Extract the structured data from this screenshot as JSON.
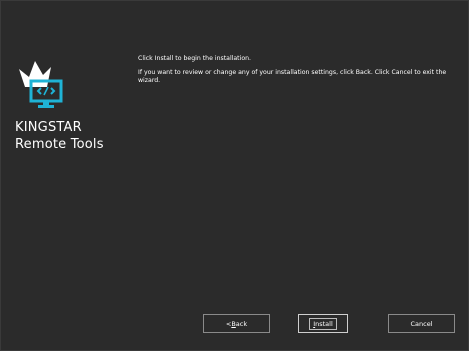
{
  "sidebar": {
    "brand_line1": "KINGSTAR",
    "brand_line2": "Remote Tools",
    "colors": {
      "crown": "#ffffff",
      "monitor": "#1fb3d6"
    }
  },
  "main": {
    "line1": "Click Install to begin the installation.",
    "line2": "If you want to review or change any of your installation settings, click Back. Click Cancel to exit the wizard."
  },
  "buttons": {
    "back_prefix": "< ",
    "back_mnemonic": "B",
    "back_rest": "ack",
    "install_mnemonic": "I",
    "install_rest": "nstall",
    "cancel": "Cancel"
  },
  "colors": {
    "background": "#2b2b2b",
    "text": "#ffffff",
    "button_border": "#8a8a8a"
  }
}
